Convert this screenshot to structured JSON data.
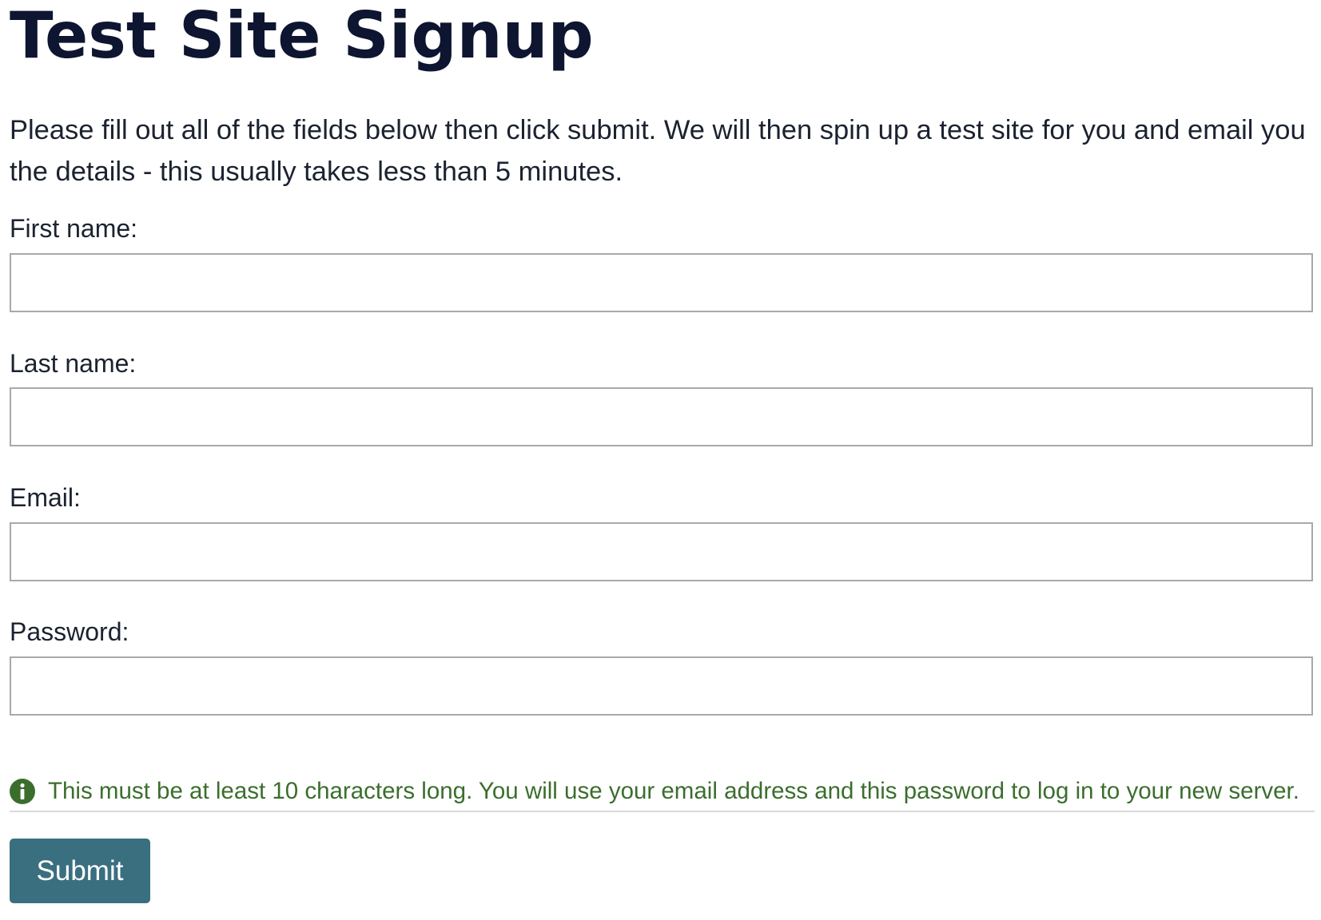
{
  "page": {
    "title": "Test Site Signup",
    "intro": "Please fill out all of the fields below then click submit. We will then spin up a test site for you and email you the details - this usually takes less than 5 minutes."
  },
  "form": {
    "first_name": {
      "label": "First name:",
      "value": "",
      "placeholder": ""
    },
    "last_name": {
      "label": "Last name:",
      "value": "",
      "placeholder": ""
    },
    "email": {
      "label": "Email:",
      "value": "",
      "placeholder": ""
    },
    "password": {
      "label": "Password:",
      "value": "",
      "placeholder": ""
    },
    "password_hint": {
      "icon": "info-icon",
      "text": "This must be at least 10 characters long. You will use your email address and this password to log in to your new server."
    },
    "submit_label": "Submit"
  },
  "colors": {
    "title": "#0e1530",
    "body_text": "#1b2230",
    "hint_text": "#3b6e2d",
    "hint_icon": "#3b6e2d",
    "input_border": "#a9a9a9",
    "button_background": "#3a6f80",
    "button_text": "#ffffff"
  }
}
